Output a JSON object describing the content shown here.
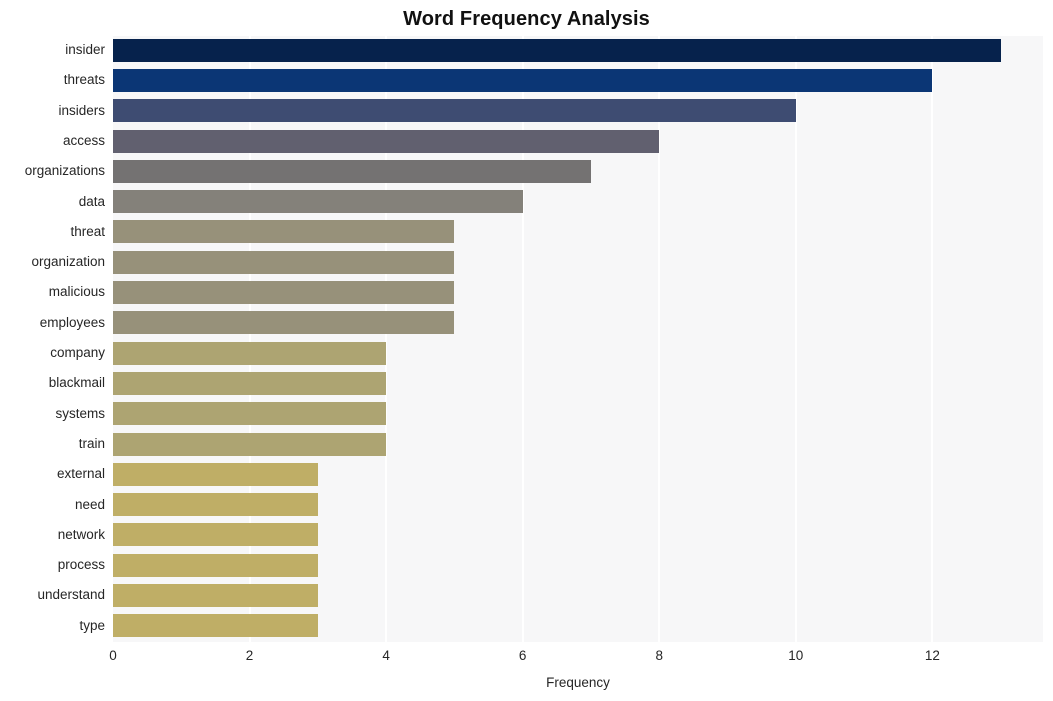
{
  "chart_data": {
    "type": "bar",
    "orientation": "horizontal",
    "title": "Word Frequency Analysis",
    "xlabel": "Frequency",
    "ylabel": "",
    "xlim": [
      0,
      13.62
    ],
    "xticks": [
      0,
      2,
      4,
      6,
      8,
      10,
      12
    ],
    "xtick_labels": [
      "0",
      "2",
      "4",
      "6",
      "8",
      "10",
      "12"
    ],
    "grid": "vertical-white",
    "legend": null,
    "categories": [
      "insider",
      "threats",
      "insiders",
      "access",
      "organizations",
      "data",
      "threat",
      "organization",
      "malicious",
      "employees",
      "company",
      "blackmail",
      "systems",
      "train",
      "external",
      "need",
      "network",
      "process",
      "understand",
      "type"
    ],
    "values": [
      13,
      12,
      10,
      8,
      7,
      6,
      5,
      5,
      5,
      5,
      4,
      4,
      4,
      4,
      3,
      3,
      3,
      3,
      3,
      3
    ],
    "bar_colors": [
      "#06224c",
      "#0b3675",
      "#3e4c72",
      "#61606f",
      "#747272",
      "#84817a",
      "#97917a",
      "#97917a",
      "#97917a",
      "#97917a",
      "#ada472",
      "#ada472",
      "#ada472",
      "#ada472",
      "#bfae66",
      "#bfae66",
      "#bfae66",
      "#bfae66",
      "#bfae66",
      "#bfae66"
    ]
  },
  "style": {
    "plot_background": "#f7f7f8",
    "figure_background": "#ffffff",
    "gridline_color": "#ffffff",
    "text_color": "#262626",
    "title_color": "#111111"
  }
}
